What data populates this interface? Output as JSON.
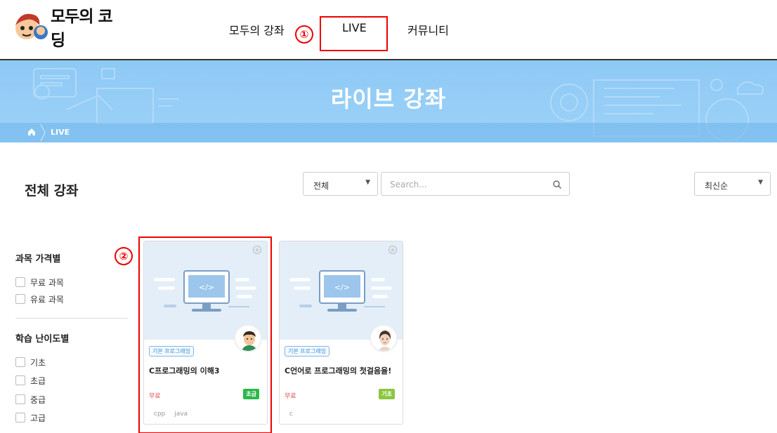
{
  "header": {
    "logo_text": "모두의 코딩",
    "nav": {
      "lectures": "모두의 강좌",
      "live": "LIVE",
      "community": "커뮤니티"
    }
  },
  "annotations": {
    "marker1": "①",
    "marker2": "②",
    "highlight_color": "#e00000"
  },
  "banner": {
    "title": "라이브 강좌",
    "breadcrumb": "LIVE",
    "color": "#8ec9f5"
  },
  "toolbar": {
    "section_title": "전체 강좌",
    "category_select": "전체",
    "search_placeholder": "Search...",
    "sort_select": "최신순"
  },
  "sidebar": {
    "price_title": "과목 가격별",
    "price_options": [
      "무료 과목",
      "유료 과목"
    ],
    "level_title": "학습 난이도별",
    "level_options": [
      "기초",
      "초급",
      "중급",
      "고급"
    ]
  },
  "courses": [
    {
      "category": "기본 프로그래밍",
      "title": "C프로그래밍의 이해3",
      "price": "무료",
      "level": "초급",
      "level_color": "#2db84a",
      "tags": [
        "cpp",
        "java"
      ]
    },
    {
      "category": "기본 프로그래밍",
      "title": "C언어로 프로그래밍의 첫걸음을!",
      "price": "무료",
      "level": "기초",
      "level_color": "#8cc63f",
      "tags": [
        "c"
      ]
    }
  ]
}
